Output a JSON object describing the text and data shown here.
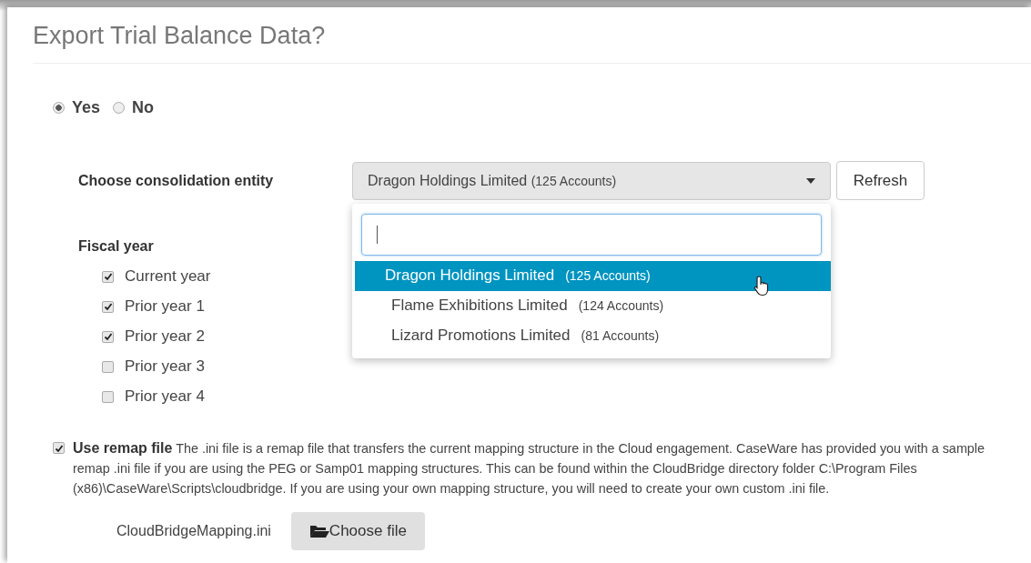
{
  "title": "Export Trial Balance Data?",
  "export_choice": [
    {
      "label": "Yes",
      "selected": true
    },
    {
      "label": "No",
      "selected": false
    }
  ],
  "entity": {
    "label": "Choose consolidation entity",
    "value": "Dragon Holdings Limited",
    "value_count": "(125 Accounts)",
    "refresh": "Refresh",
    "dropdown_open": true,
    "options": [
      {
        "name": "Dragon Holdings Limited",
        "count": "(125 Accounts)",
        "selected": true
      },
      {
        "name": "Flame Exhibitions Limited",
        "count": "(124 Accounts)",
        "selected": false
      },
      {
        "name": "Lizard Promotions Limited",
        "count": "(81 Accounts)",
        "selected": false
      }
    ]
  },
  "fiscal_year": {
    "label": "Fiscal year",
    "items": [
      {
        "label": "Current year",
        "checked": true
      },
      {
        "label": "Prior year 1",
        "checked": true
      },
      {
        "label": "Prior year 2",
        "checked": true
      },
      {
        "label": "Prior year 3",
        "checked": false
      },
      {
        "label": "Prior year 4",
        "checked": false
      }
    ]
  },
  "remap": {
    "checked": true,
    "label": "Use remap file",
    "description": "The .ini file is a remap file that transfers the current mapping structure in the Cloud engagement. CaseWare has provided you with a sample remap .ini file if you are using the PEG or Samp01 mapping structures. This can be found within the CloudBridge directory folder C:\\Program Files (x86)\\CaseWare\\Scripts\\cloudbridge. If you are using your own mapping structure, you will need to create your own custom .ini file.",
    "file_name": "CloudBridgeMapping.ini",
    "choose_button": "Choose file"
  }
}
